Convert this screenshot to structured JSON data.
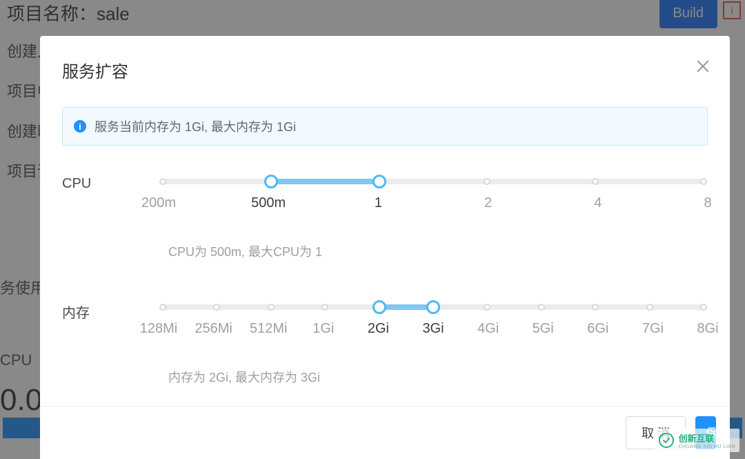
{
  "background": {
    "title": "项目名称：sale",
    "rows": [
      "创建人",
      "项目中",
      "创建时",
      "项目语"
    ],
    "usage": "务使用",
    "cpu_label": "CPU",
    "big_num": "0.0",
    "build_button": "Build"
  },
  "modal": {
    "title": "服务扩容",
    "info_message": "服务当前内存为 1Gi, 最大内存为 1Gi",
    "cpu": {
      "label": "CPU",
      "options": [
        "200m",
        "500m",
        "1",
        "2",
        "4",
        "8"
      ],
      "range_start_index": 1,
      "range_end_index": 2,
      "sub_text": "CPU为 500m, 最大CPU为 1"
    },
    "memory": {
      "label": "内存",
      "options": [
        "128Mi",
        "256Mi",
        "512Mi",
        "1Gi",
        "2Gi",
        "3Gi",
        "4Gi",
        "5Gi",
        "6Gi",
        "7Gi",
        "8Gi"
      ],
      "range_start_index": 4,
      "range_end_index": 5,
      "sub_text": "内存为 2Gi, 最大内存为 3Gi"
    },
    "footer": {
      "cancel": "取 消",
      "confirm": "保"
    }
  },
  "watermark": {
    "main": "创新互联",
    "sub": "CHUANG XIN HU LIAN"
  }
}
